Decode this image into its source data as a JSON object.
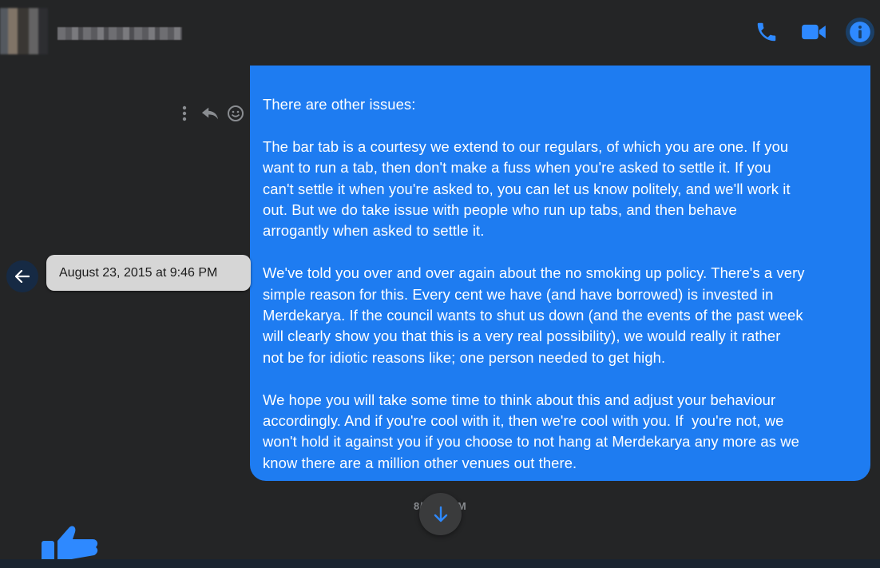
{
  "header": {
    "contact_name": "",
    "icons": [
      "phone-icon",
      "video-camera-icon",
      "info-icon"
    ],
    "accent_color": "#2e89ff"
  },
  "message": {
    "paragraphs": [
      "There are other issues:",
      "The bar tab is a courtesy we extend to our regulars, of which you are one. If you\nwant to run a tab, then don't make a fuss when you're asked to settle it. If you\ncan't settle it when you're asked to, you can let us know politely, and we'll work it\nout. But we do take issue with people who run up tabs, and then behave\narrogantly when asked to settle it.",
      "We've told you over and over again about the no smoking up policy. There's a very\nsimple reason for this. Every cent we have (and have borrowed) is invested in\nMerdekarya. If the council wants to shut us down (and the events of the past week\nwill clearly show you that this is a very real possibility), we would really it rather\nnot be for idiotic reasons like; one person needed to get high.",
      "We hope you will take some time to think about this and adjust your behaviour\naccordingly. And if you're cool with it, then we're cool with you. If  you're not, we\nwon't hold it against you if you choose to not hang at Merdekarya any more as we\nknow there are a million other venues out there."
    ],
    "bubble_color": "#1e7cf1"
  },
  "message_actions": [
    "more-options-icon",
    "reply-icon",
    "emoji-react-icon"
  ],
  "tooltip": {
    "date_label": "August 23, 2015 at 9:46 PM"
  },
  "timestamp": {
    "label": "8/27/     0 AM"
  }
}
